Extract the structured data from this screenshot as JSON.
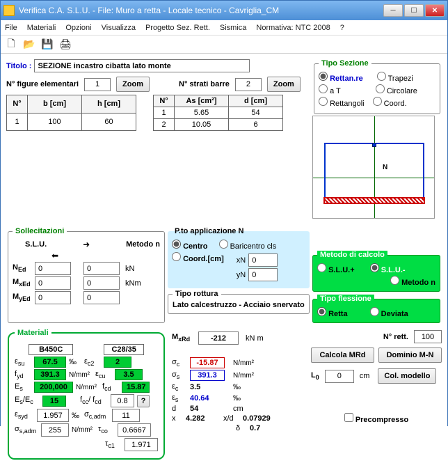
{
  "title": "Verifica C.A. S.L.U. - File: Muro a retta - Locale tecnico - Cavriglia_CM",
  "menu": {
    "file": "File",
    "materiali": "Materiali",
    "opzioni": "Opzioni",
    "visualizza": "Visualizza",
    "progetto": "Progetto Sez. Rett.",
    "sismica": "Sismica",
    "normativa": "Normativa: NTC 2008",
    "help": "?"
  },
  "toolbar": {
    "new": "🗋",
    "open": "📂",
    "save": "💾",
    "print": "🖨"
  },
  "header": {
    "titolo_label": "Titolo :",
    "titolo_value": "SEZIONE incastro cibatta lato monte",
    "n_figure_label": "N° figure elementari",
    "n_figure_value": "1",
    "zoom_label": "Zoom",
    "n_strati_label": "N° strati barre",
    "n_strati_value": "2"
  },
  "figure_table": {
    "cols": [
      "N°",
      "b [cm]",
      "h [cm]"
    ],
    "rows": [
      [
        "1",
        "100",
        "60"
      ]
    ]
  },
  "barre_table": {
    "cols": [
      "N°",
      "As [cm²]",
      "d [cm]"
    ],
    "rows": [
      [
        "1",
        "5.65",
        "54"
      ],
      [
        "2",
        "10.05",
        "6"
      ]
    ]
  },
  "tipo_sezione": {
    "legend": "Tipo Sezione",
    "rettanre": "Rettan.re",
    "trapezi": "Trapezi",
    "at": "a T",
    "circolare": "Circolare",
    "rettangoli": "Rettangoli",
    "coord": "Coord."
  },
  "sollecitazioni": {
    "legend": "Sollecitazioni",
    "slu": "S.L.U.",
    "metodon": "Metodo n",
    "n_ed_label": "N",
    "n_ed_sub": "Ed",
    "n_ed_value": "0",
    "n_ed_unit": "kN",
    "n_ed_value2": "0",
    "m_xed_label": "M",
    "m_xed_sub": "xEd",
    "m_xed_value": "0",
    "m_xed_unit": "kNm",
    "m_xed_value2": "0",
    "m_yed_label": "M",
    "m_yed_sub": "yEd",
    "m_yed_value": "0",
    "m_yed_value2": "0"
  },
  "pto": {
    "legend": "P.to applicazione N",
    "centro": "Centro",
    "baricentro": "Baricentro cls",
    "coord": "Coord.[cm]",
    "xn_label": "xN",
    "xn_value": "0",
    "yn_label": "yN",
    "yn_value": "0"
  },
  "tipo_rottura": {
    "legend": "Tipo rottura",
    "value": "Lato calcestruzzo - Acciaio snervato"
  },
  "materiali": {
    "legend": "Materiali",
    "steel": "B450C",
    "concrete": "C28/35",
    "esu_label": "ε",
    "esu_sub": "su",
    "esu_value": "67.5",
    "permil": "‰",
    "ec2_label": "ε",
    "ec2_sub": "c2",
    "ec2_value": "2",
    "fyd_label": "f",
    "fyd_sub": "yd",
    "fyd_value": "391.3",
    "nmm2": "N/mm²",
    "ecu_label": "ε",
    "ecu_sub": "cu",
    "ecu_value": "3.5",
    "es_label": "E",
    "es_sub": "s",
    "es_value": "200,000",
    "fcd_label": "f",
    "fcd_sub": "cd",
    "fcd_value": "15.87",
    "esec_label": "E",
    "esec_sub": "s",
    "esec_div": "/E",
    "esec_sub2": "c",
    "esec_value": "15",
    "fccfcd_label": "f",
    "fccfcd_sub": "cc",
    "fccfcd_div": "/ f",
    "fccfcd_sub2": "cd",
    "fccfcd_value": "0.8",
    "q": "?",
    "esyd_label": "ε",
    "esyd_sub": "syd",
    "esyd_value": "1.957",
    "scadm_label": "σ",
    "scadm_sub": "c,adm",
    "scadm_value": "11",
    "ssadm_label": "σ",
    "ssadm_sub": "s,adm",
    "ssadm_value": "255",
    "tco_label": "τ",
    "tco_sub": "co",
    "tco_value": "0.6667",
    "tc1_label": "τ",
    "tc1_sub": "c1",
    "tc1_value": "1.971"
  },
  "results": {
    "mxrd_label": "M",
    "mxrd_sub": "xRd",
    "mxrd_value": "-212",
    "mxrd_unit": "kN m",
    "sc_label": "σ",
    "sc_sub": "c",
    "sc_value": "-15.87",
    "nmm2": "N/mm²",
    "ss_label": "σ",
    "ss_sub": "s",
    "ss_value": "391.3",
    "ec_label": "ε",
    "ec_sub": "c",
    "ec_value": "3.5",
    "permil": "‰",
    "es_label": "ε",
    "es_sub": "s",
    "es_value": "40.64",
    "d_label": "d",
    "d_value": "54",
    "d_unit": "cm",
    "x_label": "x",
    "x_value": "4.282",
    "xd_label": "x/d",
    "xd_value": "0.07929",
    "delta_label": "δ",
    "delta_value": "0.7"
  },
  "metodo_calcolo": {
    "legend": "Metodo di calcolo",
    "slu_plus": "S.L.U.+",
    "slu_minus": "S.L.U.-",
    "metodon": "Metodo n"
  },
  "tipo_flessione": {
    "legend": "Tipo flessione",
    "retta": "Retta",
    "deviata": "Deviata"
  },
  "right_panel": {
    "nrett_label": "N° rett.",
    "nrett_value": "100",
    "calcola_label": "Calcola MRd",
    "dominio_label": "Dominio M-N",
    "l0_label": "L",
    "l0_sub": "0",
    "l0_value": "0",
    "l0_unit": "cm",
    "colmod_label": "Col. modello",
    "precompresso_label": "Precompresso"
  },
  "section_view": {
    "n_label": "N"
  }
}
